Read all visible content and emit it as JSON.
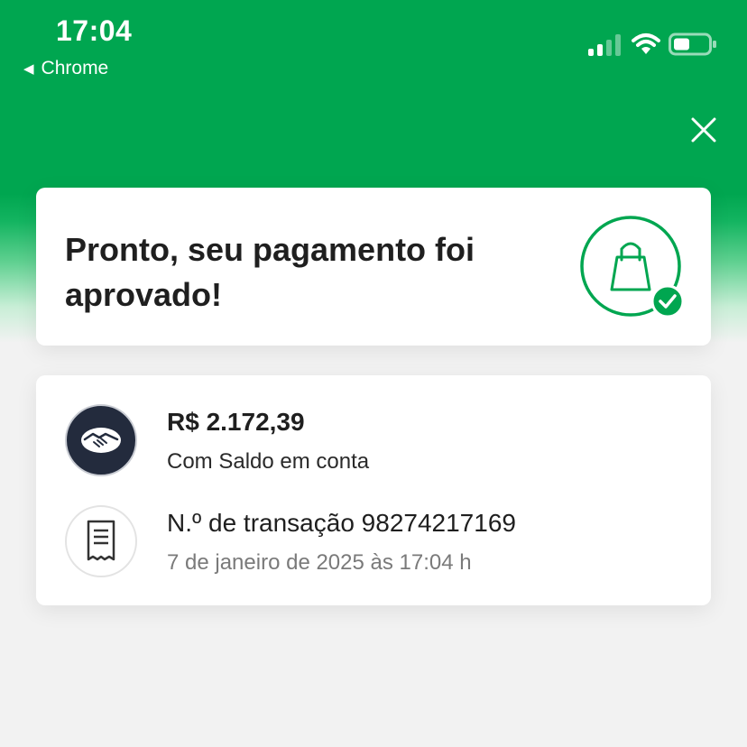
{
  "status_bar": {
    "time": "17:04",
    "back_app": "Chrome",
    "back_icon": "back-triangle-icon",
    "signal_icon": "cellular-signal-icon",
    "wifi_icon": "wifi-icon",
    "battery_icon": "battery-icon"
  },
  "header": {
    "close_icon": "close-icon",
    "brand_color": "#00a650"
  },
  "approval": {
    "title": "Pronto, seu pagamento foi aprovado!",
    "icon": "shopping-bag-check-icon"
  },
  "payment": {
    "amount": "R$ 2.172,39",
    "method": "Com Saldo em conta",
    "icon": "mercado-pago-handshake-icon"
  },
  "transaction": {
    "number_label": "N.º de transação 98274217169",
    "date": "7 de janeiro de 2025 às 17:04 h",
    "icon": "receipt-icon"
  }
}
